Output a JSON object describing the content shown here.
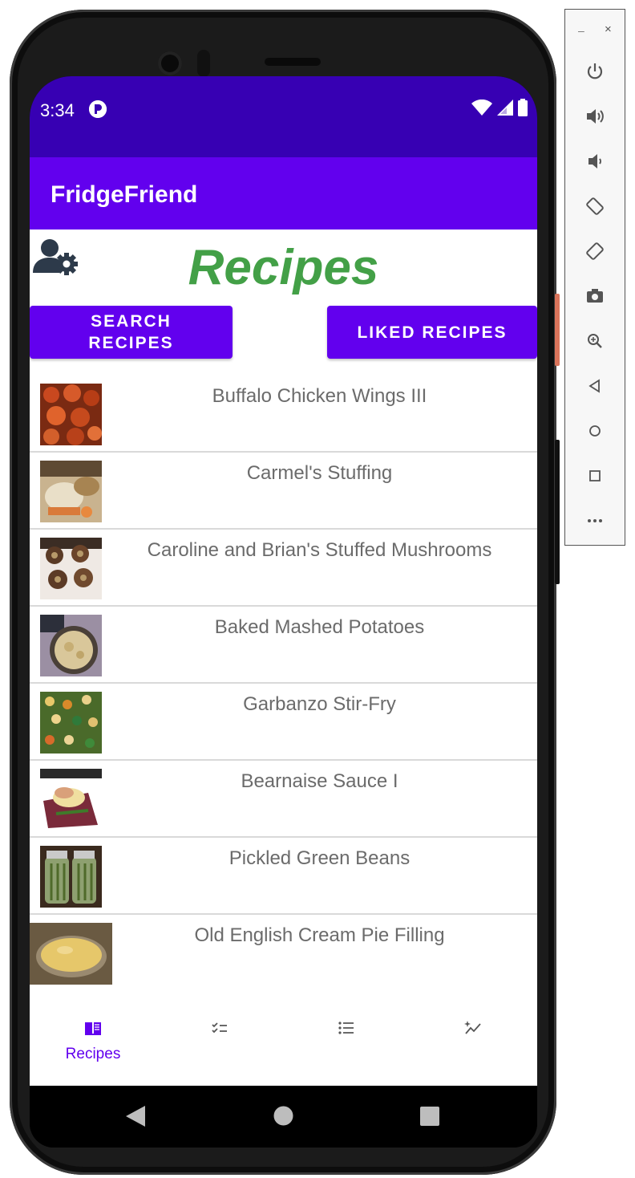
{
  "status_bar": {
    "time": "3:34"
  },
  "app_bar": {
    "title": "FridgeFriend"
  },
  "page": {
    "heading": "Recipes",
    "search_button": "SEARCH\nRECIPES",
    "liked_button": "LIKED RECIPES"
  },
  "recipes": [
    {
      "title": "Buffalo Chicken Wings III"
    },
    {
      "title": "Carmel's Stuffing"
    },
    {
      "title": "Caroline and Brian's Stuffed Mushrooms"
    },
    {
      "title": "Baked Mashed Potatoes"
    },
    {
      "title": "Garbanzo Stir-Fry"
    },
    {
      "title": "Bearnaise Sauce I"
    },
    {
      "title": "Pickled Green Beans"
    },
    {
      "title": "Old English Cream Pie Filling"
    }
  ],
  "bottom_nav": {
    "items": [
      {
        "label": "Recipes",
        "icon": "book-icon",
        "active": true
      },
      {
        "label": "",
        "icon": "checklist-icon",
        "active": false
      },
      {
        "label": "",
        "icon": "list-icon",
        "active": false
      },
      {
        "label": "",
        "icon": "sparkle-chart-icon",
        "active": false
      }
    ]
  },
  "emulator_controls": [
    "power-icon",
    "volume-up-icon",
    "volume-down-icon",
    "rotate-left-icon",
    "rotate-right-icon",
    "camera-icon",
    "zoom-icon",
    "back-icon",
    "home-icon",
    "overview-icon",
    "more-icon"
  ],
  "colors": {
    "status_bar": "#3700b3",
    "primary": "#6200ee",
    "heading": "#43a047",
    "list_text": "#6b6b6b"
  }
}
